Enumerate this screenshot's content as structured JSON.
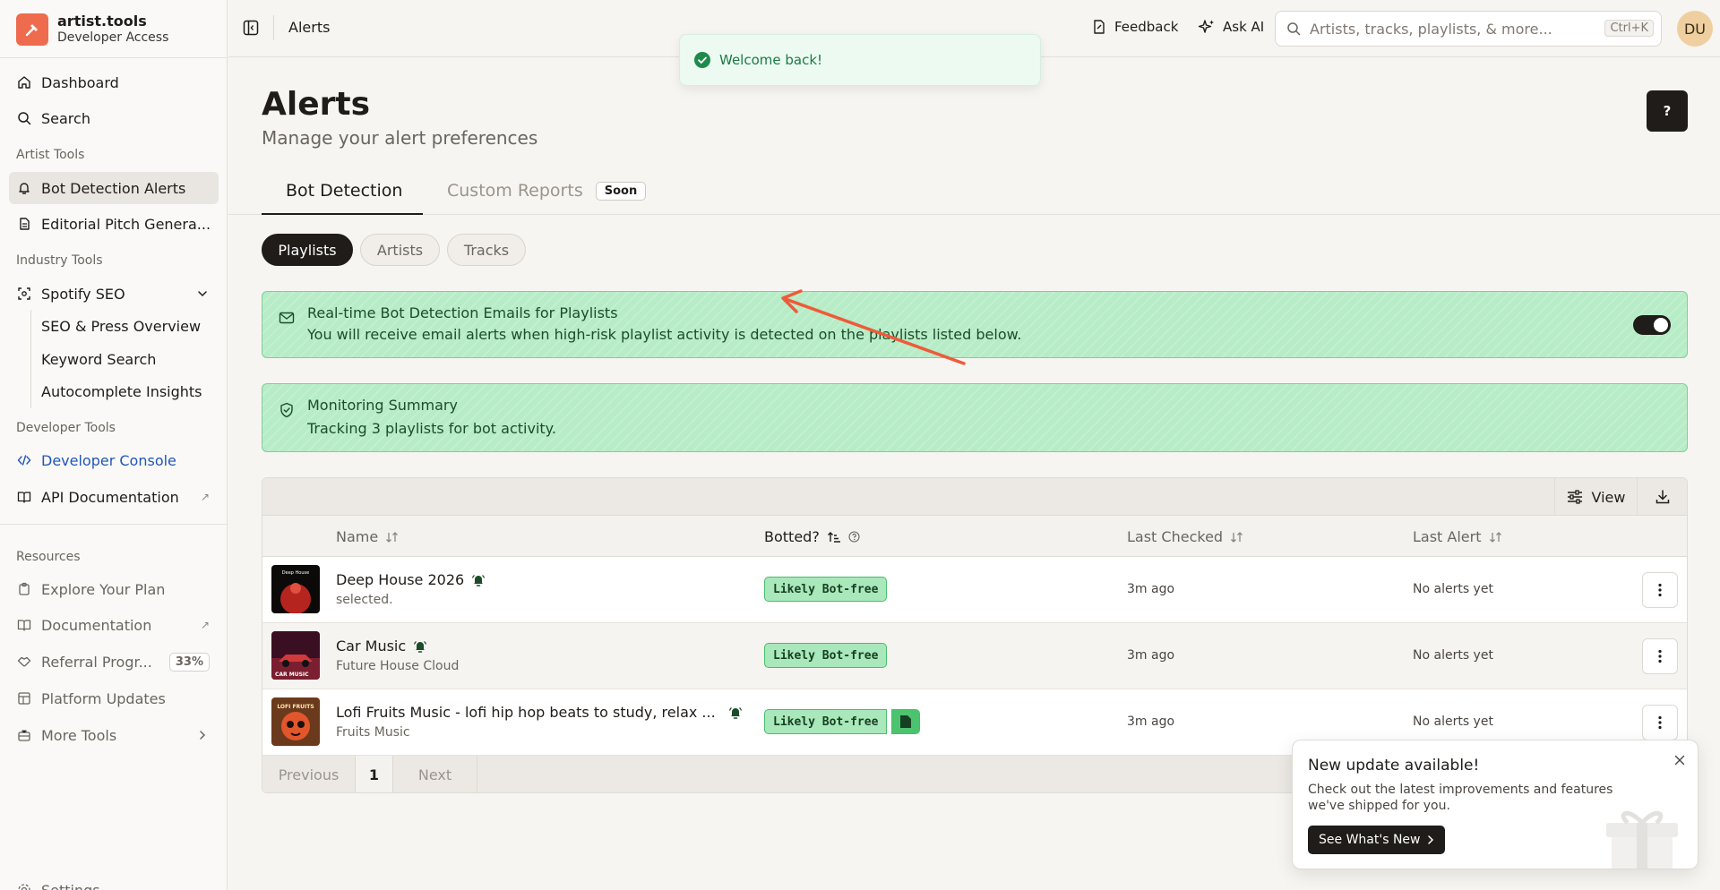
{
  "brand": {
    "name": "artist.tools",
    "subtitle": "Developer Access",
    "accent": "#ee6c4d"
  },
  "sidebar": {
    "main": [
      {
        "label": "Dashboard",
        "icon": "home-icon"
      },
      {
        "label": "Search",
        "icon": "search-icon"
      }
    ],
    "artist_tools": {
      "title": "Artist Tools",
      "items": [
        {
          "label": "Bot Detection Alerts",
          "icon": "bell-icon",
          "active": true
        },
        {
          "label": "Editorial Pitch Genera...",
          "icon": "document-icon"
        }
      ]
    },
    "industry_tools": {
      "title": "Industry Tools",
      "spotify_seo": {
        "label": "Spotify SEO",
        "icon": "scan-icon"
      },
      "sub_items": [
        "SEO & Press Overview",
        "Keyword Search",
        "Autocomplete Insights"
      ]
    },
    "developer_tools": {
      "title": "Developer Tools",
      "items": [
        {
          "label": "Developer Console",
          "icon": "code-icon"
        },
        {
          "label": "API Documentation",
          "icon": "book-icon"
        }
      ]
    },
    "resources": {
      "title": "Resources",
      "items": [
        {
          "label": "Explore Your Plan",
          "icon": "clipboard-icon"
        },
        {
          "label": "Documentation",
          "icon": "book-icon"
        },
        {
          "label": "Referral Progr...",
          "icon": "handshake-icon",
          "badge": "33%"
        },
        {
          "label": "Platform Updates",
          "icon": "layout-icon"
        },
        {
          "label": "More Tools",
          "icon": "toolbox-icon"
        }
      ]
    },
    "settings": "Settings"
  },
  "header": {
    "title": "Alerts",
    "feedback": "Feedback",
    "ask_ai": "Ask AI",
    "search_placeholder": "Artists, tracks, playlists, & more...",
    "shortcut": "Ctrl+K",
    "avatar": "DU"
  },
  "toast": {
    "message": "Welcome back!"
  },
  "page": {
    "title": "Alerts",
    "subtitle": "Manage your alert preferences",
    "help": "?"
  },
  "tabs": {
    "active": "Bot Detection",
    "inactive": "Custom Reports",
    "soon": "Soon"
  },
  "filters": [
    "Playlists",
    "Artists",
    "Tracks"
  ],
  "email_banner": {
    "title": "Real-time Bot Detection Emails for Playlists",
    "description": "You will receive email alerts when high-risk playlist activity is detected on the playlists listed below.",
    "enabled": true
  },
  "summary_banner": {
    "title": "Monitoring Summary",
    "description": "Tracking 3 playlists for bot activity."
  },
  "table": {
    "view_label": "View",
    "columns": {
      "name": "Name",
      "botted": "Botted?",
      "last_checked": "Last Checked",
      "last_alert": "Last Alert"
    },
    "rows": [
      {
        "name": "Deep House 2026",
        "subtitle": "selected.",
        "status": "Likely Bot-free",
        "last_checked": "3m ago",
        "last_alert": "No alerts yet",
        "thumb_text": "Deep House"
      },
      {
        "name": "Car Music",
        "subtitle": "Future House Cloud",
        "status": "Likely Bot-free",
        "last_checked": "3m ago",
        "last_alert": "No alerts yet",
        "thumb_text": "CAR MUSIC"
      },
      {
        "name": "Lofi Fruits Music - lofi hip hop beats to study, relax ...",
        "subtitle": "Fruits Music",
        "status": "Likely Bot-free",
        "last_checked": "3m ago",
        "last_alert": "No alerts yet",
        "thumb_text": "LOFI FRUITS"
      }
    ],
    "pagination": {
      "previous": "Previous",
      "current": "1",
      "next": "Next"
    }
  },
  "update_popup": {
    "title": "New update available!",
    "description": "Check out the latest improvements and features we've shipped for you.",
    "button": "See What's New"
  }
}
